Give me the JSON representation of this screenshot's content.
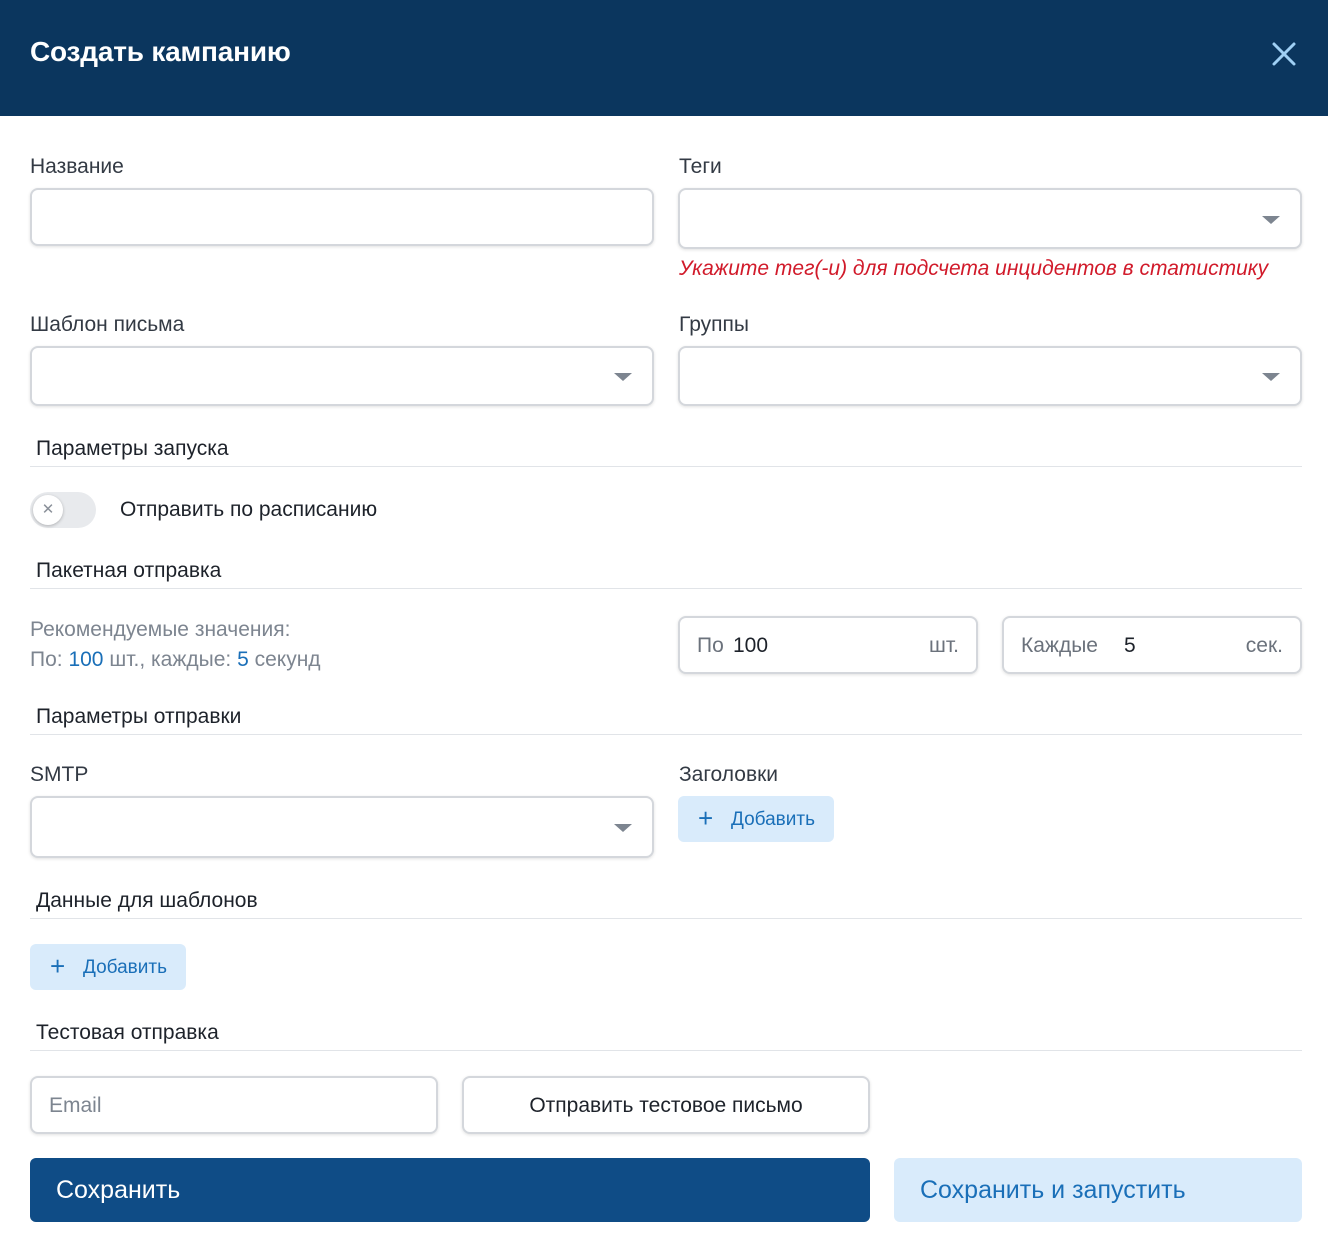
{
  "header": {
    "title": "Создать кампанию",
    "background": "#0b365e"
  },
  "fields": {
    "name_label": "Название",
    "tags_label": "Теги",
    "tags_error": "Укажите тег(-и) для подсчета инцидентов в статистику",
    "template_label": "Шаблон письма",
    "groups_label": "Группы"
  },
  "launch": {
    "section_title": "Параметры запуска",
    "schedule_toggle_label": "Отправить по расписанию",
    "schedule_toggle_on": false
  },
  "batch": {
    "section_title": "Пакетная отправка",
    "recommended_line1": "Рекомендуемые значения:",
    "rec_prefix": "По:",
    "rec_count": "100",
    "rec_middle": "шт., каждые:",
    "rec_seconds": "5",
    "rec_suffix": "секунд",
    "count_prefix": "По",
    "count_value": "100",
    "count_suffix": "шт.",
    "interval_prefix": "Каждые",
    "interval_value": "5",
    "interval_suffix": "сек."
  },
  "send_params": {
    "section_title": "Параметры отправки",
    "smtp_label": "SMTP",
    "headers_label": "Заголовки",
    "headers_add": "Добавить"
  },
  "template_data": {
    "section_title": "Данные для шаблонов",
    "add": "Добавить"
  },
  "test_send": {
    "section_title": "Тестовая отправка",
    "email_placeholder": "Email",
    "send_button": "Отправить тестовое письмо"
  },
  "footer": {
    "save": "Сохранить",
    "save_and_run": "Сохранить и запустить",
    "accent": "#0f4c86"
  }
}
